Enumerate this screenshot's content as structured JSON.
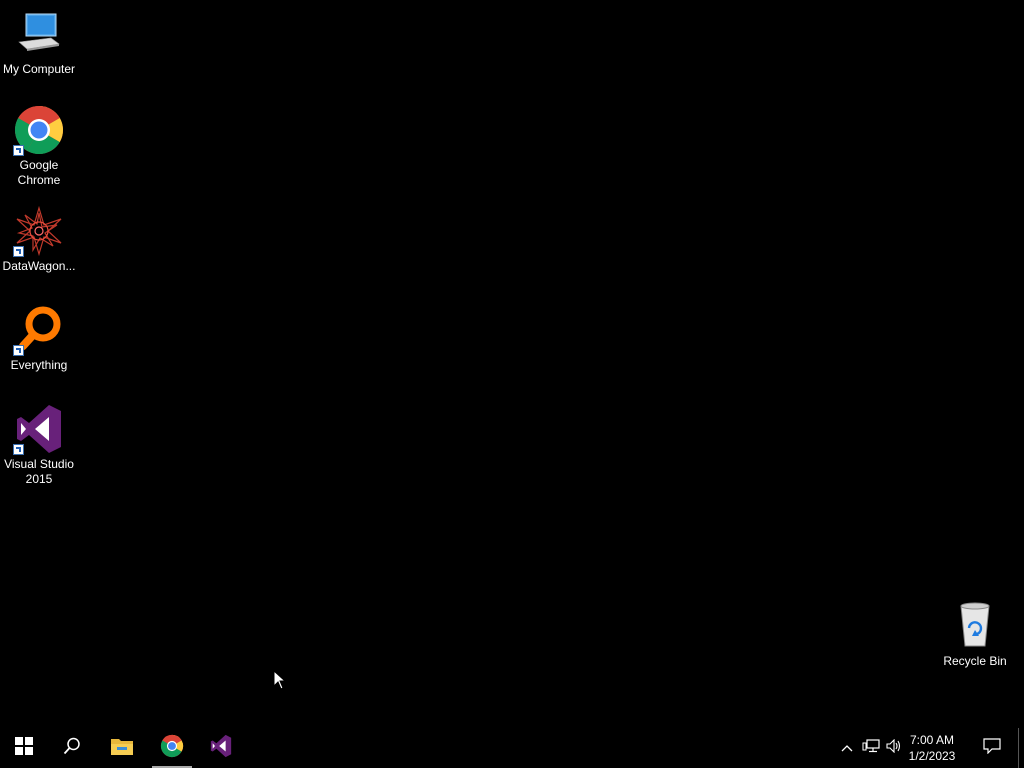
{
  "desktop": {
    "icons": [
      {
        "label": "My Computer",
        "icon": "computer-icon"
      },
      {
        "label": "Google Chrome",
        "icon": "chrome-icon"
      },
      {
        "label": "DataWagon...",
        "icon": "datawagon-icon"
      },
      {
        "label": "Everything",
        "icon": "everything-icon"
      },
      {
        "label": "Visual Studio 2015",
        "icon": "visual-studio-icon"
      },
      {
        "label": "Recycle Bin",
        "icon": "recycle-bin-icon"
      }
    ]
  },
  "taskbar": {
    "pinned": [
      {
        "icon": "windows-start-icon"
      },
      {
        "icon": "search-icon"
      },
      {
        "icon": "file-explorer-icon"
      },
      {
        "icon": "chrome-icon",
        "active": true
      },
      {
        "icon": "visual-studio-icon"
      }
    ],
    "tray": {
      "icons": [
        "chevron-up-icon",
        "network-icon",
        "volume-icon"
      ],
      "time": "7:00 AM",
      "date": "1/2/2023",
      "notification_icon": "action-center-icon"
    }
  },
  "colors": {
    "background": "#000000",
    "vs_purple": "#68217a",
    "everything_orange": "#ff7a00"
  }
}
